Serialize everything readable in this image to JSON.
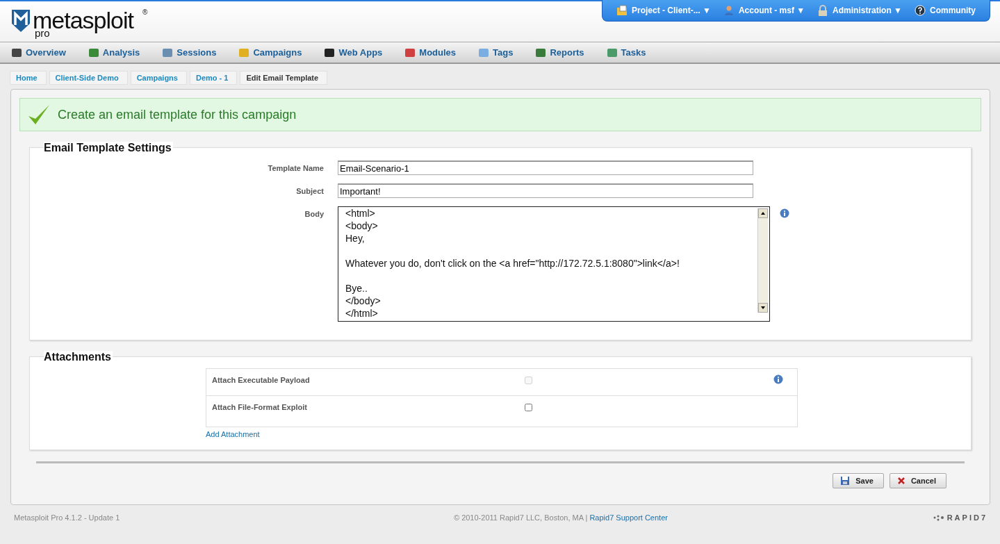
{
  "logo": {
    "name": "metasploit",
    "mark": "®",
    "edition": "pro"
  },
  "top_menu": [
    {
      "label": "Project - Client-... ▼"
    },
    {
      "label": "Account - msf ▼"
    },
    {
      "label": "Administration ▼"
    },
    {
      "label": "Community"
    }
  ],
  "nav": [
    {
      "label": "Overview"
    },
    {
      "label": "Analysis"
    },
    {
      "label": "Sessions"
    },
    {
      "label": "Campaigns"
    },
    {
      "label": "Web Apps"
    },
    {
      "label": "Modules"
    },
    {
      "label": "Tags"
    },
    {
      "label": "Reports"
    },
    {
      "label": "Tasks"
    }
  ],
  "breadcrumb": [
    {
      "label": "Home",
      "current": false
    },
    {
      "label": "Client-Side Demo",
      "current": false
    },
    {
      "label": "Campaigns",
      "current": false
    },
    {
      "label": "Demo - 1",
      "current": false
    },
    {
      "label": "Edit Email Template",
      "current": true
    }
  ],
  "banner": "Create an email template for this campaign",
  "settings": {
    "title": "Email Template Settings",
    "fields": [
      {
        "label": "Template Name",
        "value": "Email-Scenario-1"
      },
      {
        "label": "Subject",
        "value": "Important!"
      }
    ],
    "body": {
      "label": "Body",
      "value": "<html>\n<body>\nHey,\n\nWhatever you do, don't click on the <a href=\"http://172.72.5.1:8080\">link</a>!\n\nBye..\n</body>\n</html>"
    }
  },
  "attachments": {
    "title": "Attachments",
    "rows": [
      {
        "label": "Attach Executable Payload",
        "checked": false,
        "disabled": true,
        "info": true
      },
      {
        "label": "Attach File-Format Exploit",
        "checked": false,
        "disabled": false,
        "info": false
      }
    ],
    "add_link": "Add Attachment"
  },
  "buttons": [
    {
      "label": "Save",
      "kind": "save"
    },
    {
      "label": "Cancel",
      "kind": "cancel"
    }
  ],
  "footer": {
    "version": "Metasploit Pro 4.1.2 - Update 1",
    "copyright": "© 2010-2011 Rapid7 LLC, Boston, MA |",
    "link": "Rapid7 Support Center",
    "brand": "RAPID7"
  }
}
